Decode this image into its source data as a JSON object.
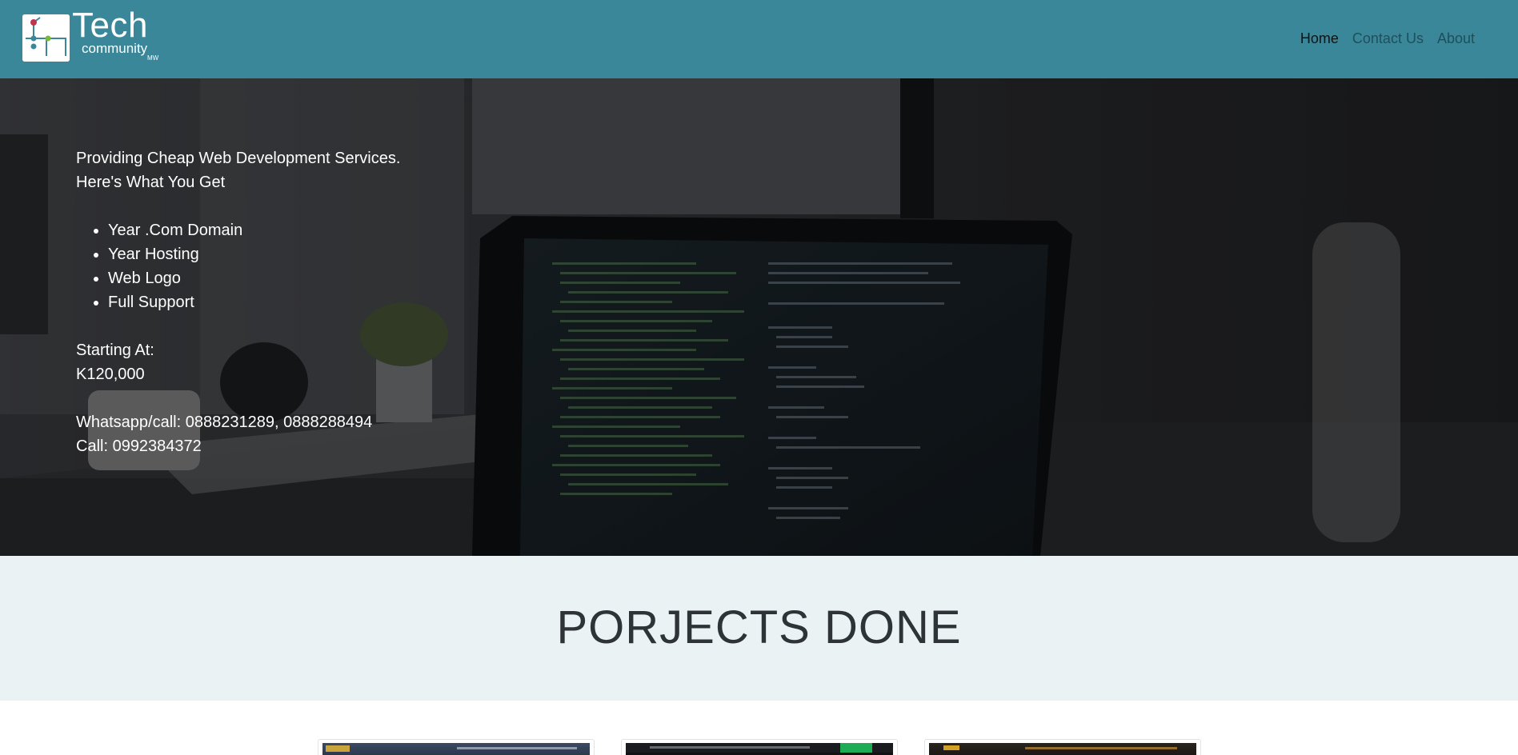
{
  "header": {
    "logo": {
      "tech": "Tech",
      "community": "community",
      "mw": "MW"
    },
    "nav": [
      {
        "label": "Home",
        "active": true
      },
      {
        "label": "Contact Us",
        "active": false
      },
      {
        "label": "About",
        "active": false
      }
    ],
    "background_color": "#3a8799"
  },
  "hero": {
    "headline_1": "Providing Cheap Web Development Services.",
    "headline_2": "Here's What You Get",
    "features": [
      "Year .Com Domain",
      "Year Hosting",
      "Web Logo",
      "Full Support"
    ],
    "price_label": "Starting At:",
    "price_value": "K120,000",
    "whatsapp": "Whatsapp/call: 0888231289, 0888288494",
    "call": "Call: 0992384372",
    "background_image": "desk-laptop-code-photo"
  },
  "projects": {
    "title": "PORJECTS DONE",
    "cards": [
      {
        "name": "project-1"
      },
      {
        "name": "project-2"
      },
      {
        "name": "project-3"
      }
    ]
  }
}
